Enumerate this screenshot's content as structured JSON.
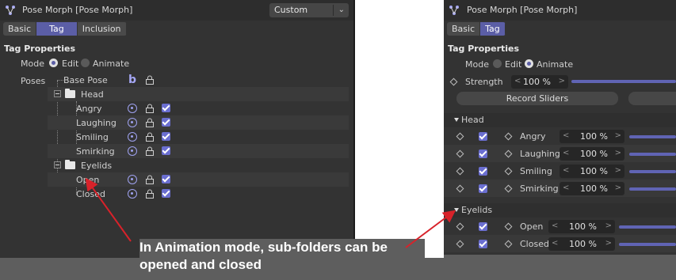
{
  "left_panel": {
    "title": "Pose Morph [Pose Morph]",
    "dropdown_value": "Custom",
    "tabs": [
      {
        "label": "Basic",
        "active": false
      },
      {
        "label": "Tag",
        "active": true
      },
      {
        "label": "Inclusion",
        "active": false
      }
    ],
    "section_title": "Tag Properties",
    "mode_label": "Mode",
    "mode_options": [
      {
        "label": "Edit",
        "selected": true
      },
      {
        "label": "Animate",
        "selected": false
      }
    ],
    "poses_label": "Poses",
    "tree": {
      "base_pose": "Base Pose",
      "base_pose_icon": "b",
      "groups": [
        {
          "name": "Head",
          "items": [
            "Angry",
            "Laughing",
            "Smiling",
            "Smirking"
          ]
        },
        {
          "name": "Eyelids",
          "items": [
            "Open",
            "Closed"
          ]
        }
      ]
    }
  },
  "right_panel": {
    "title": "Pose Morph [Pose Morph]",
    "tabs": [
      {
        "label": "Basic",
        "active": false
      },
      {
        "label": "Tag",
        "active": true
      }
    ],
    "section_title": "Tag Properties",
    "mode_label": "Mode",
    "mode_options": [
      {
        "label": "Edit",
        "selected": false
      },
      {
        "label": "Animate",
        "selected": true
      }
    ],
    "strength_label": "Strength",
    "strength_value": "100 %",
    "strength_level": 1.0,
    "record_button": "Record Sliders",
    "groups": [
      {
        "name": "Head",
        "items": [
          {
            "label": "Angry",
            "value": "100 %"
          },
          {
            "label": "Laughing",
            "value": "100 %"
          },
          {
            "label": "Smiling",
            "value": "100 %"
          },
          {
            "label": "Smirking",
            "value": "100 %"
          }
        ]
      },
      {
        "name": "Eyelids",
        "items": [
          {
            "label": "Open",
            "value": "100 %"
          },
          {
            "label": "Closed",
            "value": "100 %"
          }
        ]
      }
    ]
  },
  "annotation": {
    "text": "In Animation mode, sub-folders can be opened and closed",
    "arrow_color": "#d8222a"
  },
  "colors": {
    "accent": "#5b5ea6",
    "checkbox": "#6a6ed0",
    "panel_bg": "#333333",
    "band_bg": "#5e5e5e"
  }
}
